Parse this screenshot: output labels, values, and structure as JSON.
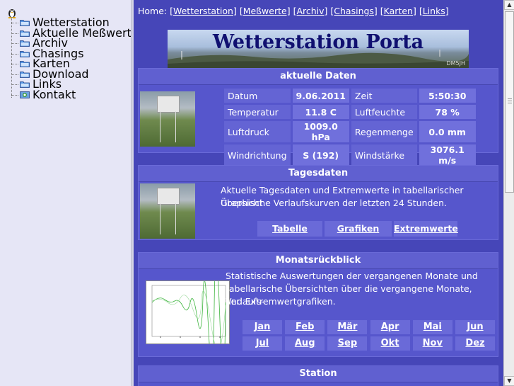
{
  "sidebar": {
    "items": [
      {
        "label": "Wetterstation",
        "icon": "folder-icon"
      },
      {
        "label": "Aktuelle Meßwerte",
        "icon": "folder-icon"
      },
      {
        "label": "Archiv",
        "icon": "folder-icon"
      },
      {
        "label": "Chasings",
        "icon": "folder-icon"
      },
      {
        "label": "Karten",
        "icon": "folder-icon"
      },
      {
        "label": "Download",
        "icon": "folder-icon"
      },
      {
        "label": "Links",
        "icon": "folder-icon"
      },
      {
        "label": "Kontakt",
        "icon": "contact-icon"
      }
    ]
  },
  "nav": {
    "prefix": "Home: ",
    "links": [
      "[Wetterstation]",
      "[Meßwerte]",
      "[Archiv]",
      "[Chasings]",
      "[Karten]",
      "[Links]"
    ]
  },
  "banner": {
    "title": "Wetterstation Porta",
    "callsign": "DM5JH"
  },
  "current": {
    "heading": "aktuelle Daten",
    "rows": [
      {
        "l1": "Datum",
        "v1": "9.06.2011",
        "l2": "Zeit",
        "v2": "5:50:30"
      },
      {
        "l1": "Temperatur",
        "v1": "11.8 C",
        "l2": "Luftfeuchte",
        "v2": "78 %"
      },
      {
        "l1": "Luftdruck",
        "v1": "1009.0 hPa",
        "l2": "Regenmenge",
        "v2": "0.0 mm"
      },
      {
        "l1": "Windrichtung",
        "v1": "S (192)",
        "l2": "Windstärke",
        "v2": "3076.1 m/s"
      }
    ]
  },
  "daily": {
    "heading": "Tagesdaten",
    "text1": "Aktuelle Tagesdaten und Extremwerte in tabellarischer Übersicht.",
    "text2": "Graphische Verlaufskurven der letzten 24 Stunden.",
    "buttons": [
      "Tabelle",
      "Grafiken",
      "Extremwerte"
    ]
  },
  "monthly": {
    "heading": "Monatsrückblick",
    "text1": "Statistische Auswertungen der vergangenen Monate und",
    "text2": "tabellarische Übersichten über die vergangene Monate, Verlaufs-",
    "text3": "und Extremwertgrafiken.",
    "months": [
      "Jan",
      "Feb",
      "Mär",
      "Apr",
      "Mai",
      "Jun",
      "Jul",
      "Aug",
      "Sep",
      "Okt",
      "Nov",
      "Dez"
    ]
  },
  "station": {
    "heading": "Station"
  },
  "colors": {
    "main_bg": "#4646b8",
    "section_bg": "#5656cc",
    "sidebar_bg": "#e6e6f6"
  }
}
